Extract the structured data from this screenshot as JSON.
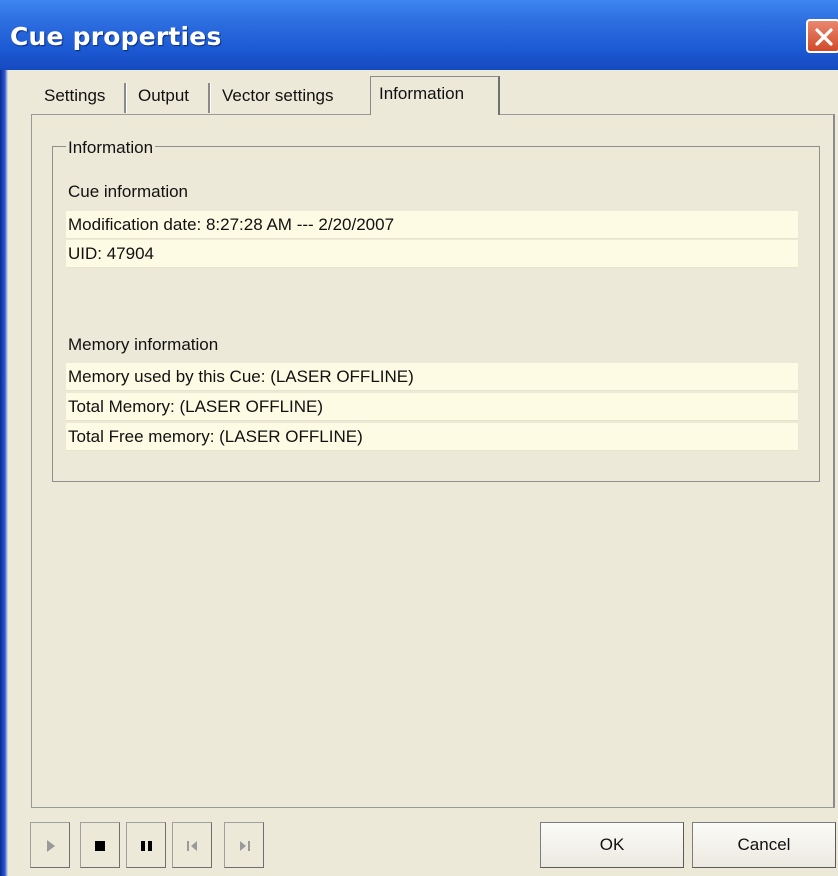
{
  "window": {
    "title": "Cue properties"
  },
  "tabs": [
    {
      "label": "Settings",
      "active": false
    },
    {
      "label": "Output",
      "active": false
    },
    {
      "label": "Vector settings",
      "active": false
    },
    {
      "label": "Information",
      "active": true
    }
  ],
  "information": {
    "group_title": "Information",
    "cue_section": {
      "heading": "Cue information",
      "rows": [
        "Modification date: 8:27:28 AM --- 2/20/2007",
        "UID: 47904"
      ]
    },
    "memory_section": {
      "heading": "Memory information",
      "rows": [
        "Memory used by this Cue: (LASER OFFLINE)",
        "Total Memory: (LASER OFFLINE)",
        "Total Free memory: (LASER OFFLINE)"
      ]
    }
  },
  "transport": [
    {
      "icon": "play-icon",
      "enabled": false
    },
    {
      "icon": "stop-icon",
      "enabled": true
    },
    {
      "icon": "pause-icon",
      "enabled": true
    },
    {
      "icon": "skip-back-icon",
      "enabled": false
    },
    {
      "icon": "skip-forward-icon",
      "enabled": false
    }
  ],
  "buttons": {
    "ok_label": "OK",
    "cancel_label": "Cancel"
  },
  "colors": {
    "titlebar": "#1c5ad4",
    "dialog_bg": "#ece9d8",
    "info_row_bg": "#fdfbe3",
    "close_button": "#d14a2a"
  }
}
